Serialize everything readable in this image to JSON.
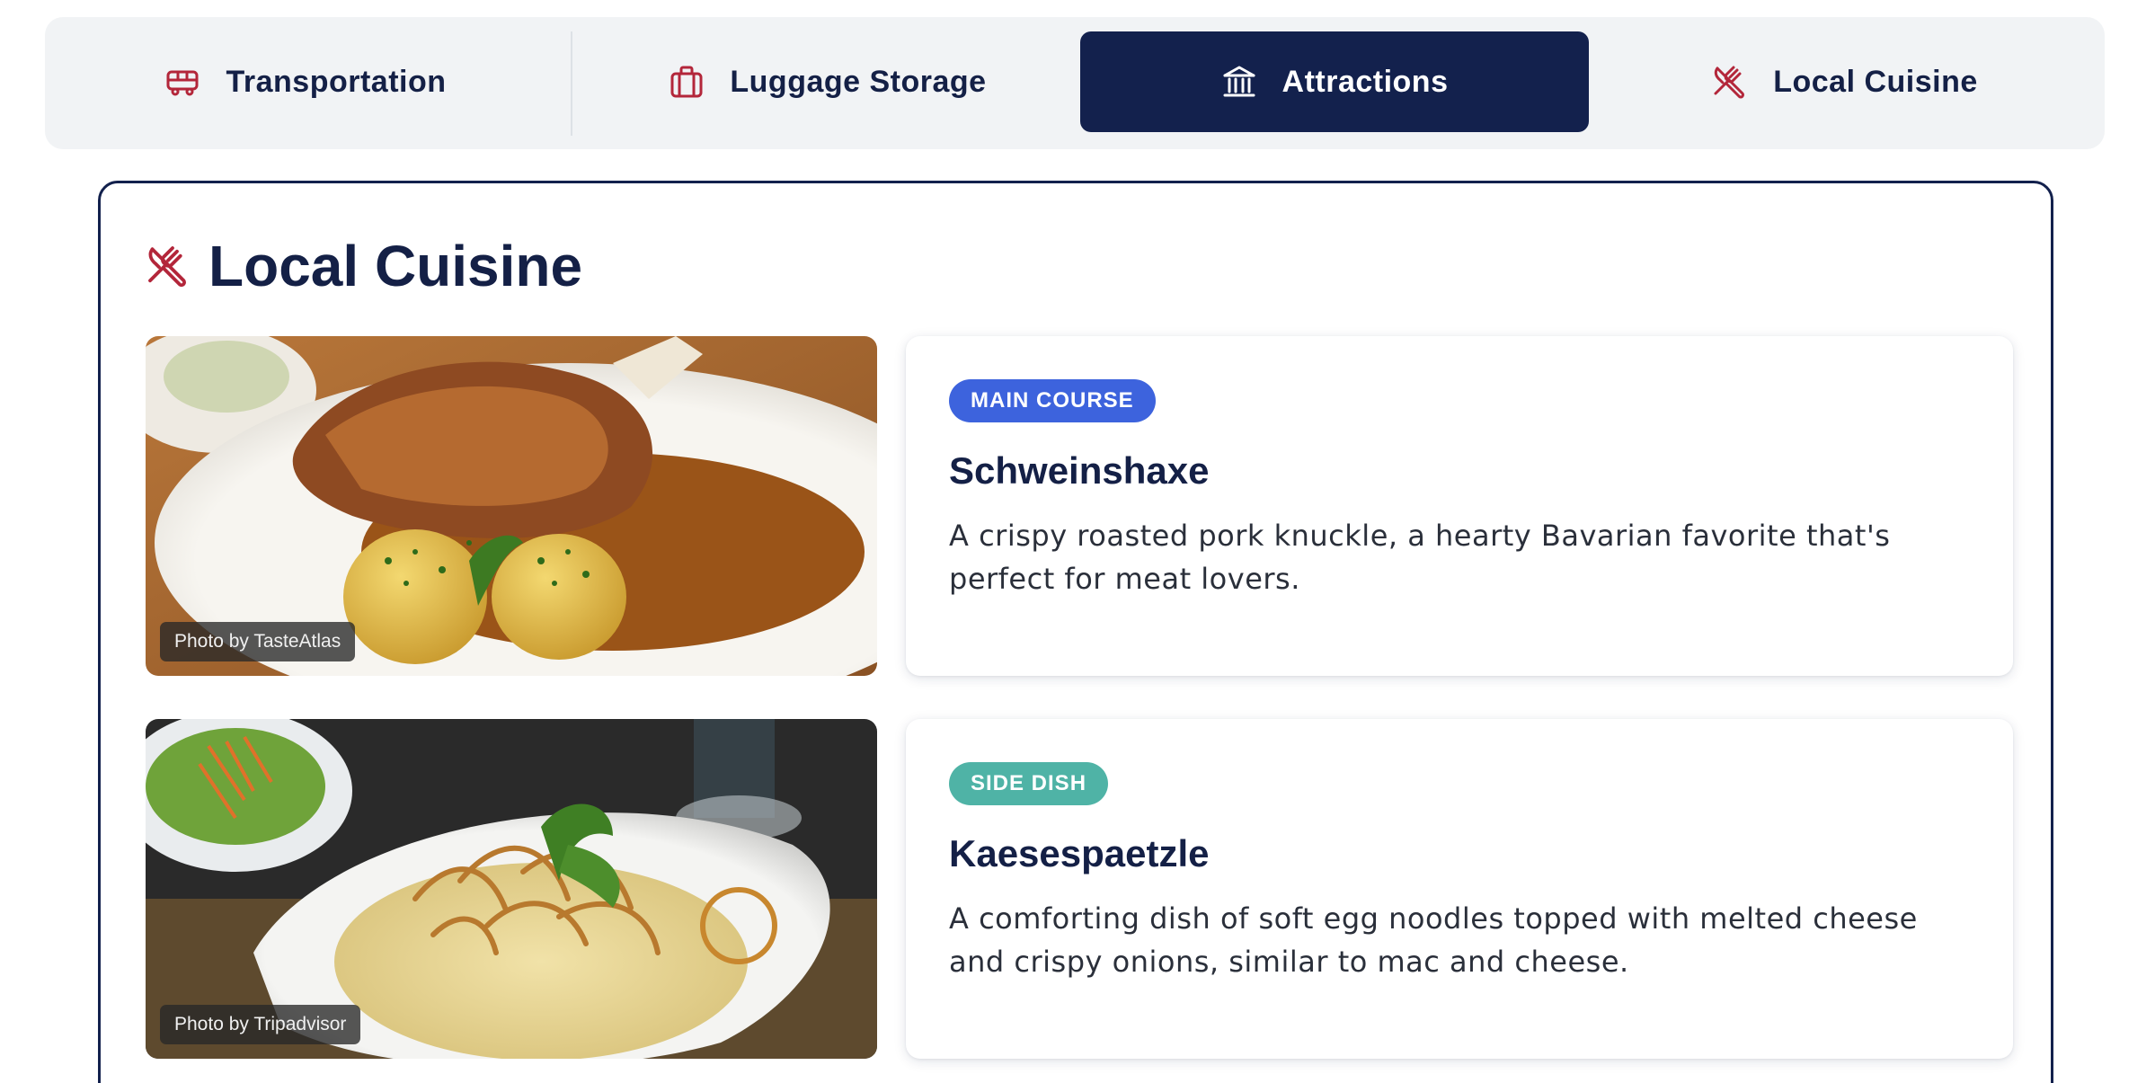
{
  "tabs": [
    {
      "label": "Transportation",
      "icon": "bus-icon",
      "active": false
    },
    {
      "label": "Luggage Storage",
      "icon": "luggage-icon",
      "active": false
    },
    {
      "label": "Attractions",
      "icon": "landmark-icon",
      "active": true
    },
    {
      "label": "Local Cuisine",
      "icon": "utensils-crossed-icon",
      "active": false
    }
  ],
  "section": {
    "title": "Local Cuisine",
    "icon": "utensils-crossed-icon"
  },
  "dishes": [
    {
      "category": "MAIN COURSE",
      "category_color": "#3d63dd",
      "name": "Schweinshaxe",
      "description": "A crispy roasted pork knuckle, a hearty Bavarian favorite that's perfect for meat lovers.",
      "photo_credit": "Photo by TasteAtlas"
    },
    {
      "category": "SIDE DISH",
      "category_color": "#4fb3a6",
      "name": "Kaesespaetzle",
      "description": "A comforting dish of soft egg noodles topped with melted cheese and crispy onions, similar to mac and cheese.",
      "photo_credit": "Photo by Tripadvisor"
    }
  ],
  "colors": {
    "navy": "#13214d",
    "accent_red": "#b3263a",
    "tabbar_bg": "#f1f3f5"
  }
}
